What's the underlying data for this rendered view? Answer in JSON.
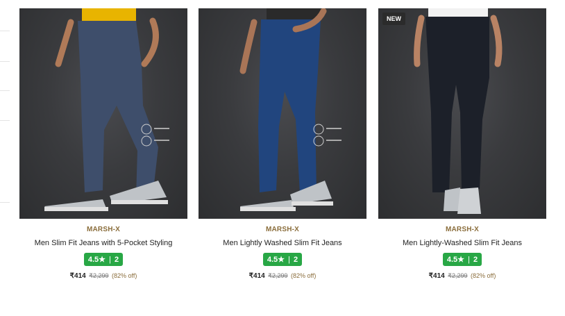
{
  "products": [
    {
      "badge": "",
      "brand": "MARSH-X",
      "name": "Men Slim Fit Jeans with 5-Pocket Styling",
      "rating": "4.5",
      "star": "★",
      "rating_sep": "|",
      "rating_count": "2",
      "price": "₹414",
      "mrp": "₹2,299",
      "discount": "(82% off)",
      "jeans_color": "#3e4e6b",
      "shirt_color": "#e8b400"
    },
    {
      "badge": "",
      "brand": "MARSH-X",
      "name": "Men Lightly Washed Slim Fit Jeans",
      "rating": "4.5",
      "star": "★",
      "rating_sep": "|",
      "rating_count": "2",
      "price": "₹414",
      "mrp": "₹2,299",
      "discount": "(82% off)",
      "jeans_color": "#21457e",
      "shirt_color": "#2a2a2a"
    },
    {
      "badge": "NEW",
      "brand": "MARSH-X",
      "name": "Men Lightly-Washed Slim Fit Jeans",
      "rating": "4.5",
      "star": "★",
      "rating_sep": "|",
      "rating_count": "2",
      "price": "₹414",
      "mrp": "₹2,299",
      "discount": "(82% off)",
      "jeans_color": "#1c2029",
      "shirt_color": "#f2f2f2"
    }
  ],
  "colors": {
    "brand": "#8a6d3b",
    "rating_bg": "#28a745",
    "image_bg": "#3a3b3e"
  }
}
